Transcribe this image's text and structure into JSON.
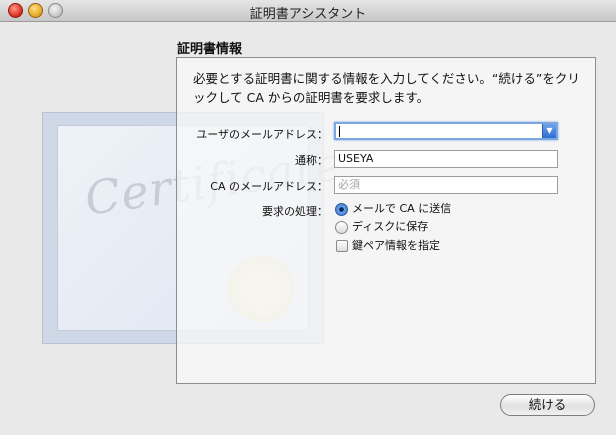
{
  "window": {
    "title": "証明書アシスタント"
  },
  "section_title": "証明書情報",
  "description": "必要とする証明書に関する情報を入力してください。“続ける”をクリックして CA からの証明書を要求します。",
  "background_art": {
    "cert_word": "Certificate"
  },
  "form": {
    "user_email": {
      "label": "ユーザのメールアドレス：",
      "value": ""
    },
    "common_name": {
      "label": "通称：",
      "value": "USEYA"
    },
    "ca_email": {
      "label": "CA のメールアドレス：",
      "placeholder": "必須"
    },
    "request": {
      "label": "要求の処理：",
      "options": [
        {
          "label": "メールで CA に送信",
          "selected": true
        },
        {
          "label": "ディスクに保存",
          "selected": false
        }
      ],
      "checkbox": {
        "label": "鍵ペア情報を指定",
        "checked": false
      }
    }
  },
  "buttons": {
    "continue_label": "続ける"
  },
  "colors": {
    "focus_ring": "#7aa7e0",
    "radio_selected": "#2c6bcc",
    "close_button": "#d8281a",
    "minimize_button": "#e4a21a"
  }
}
